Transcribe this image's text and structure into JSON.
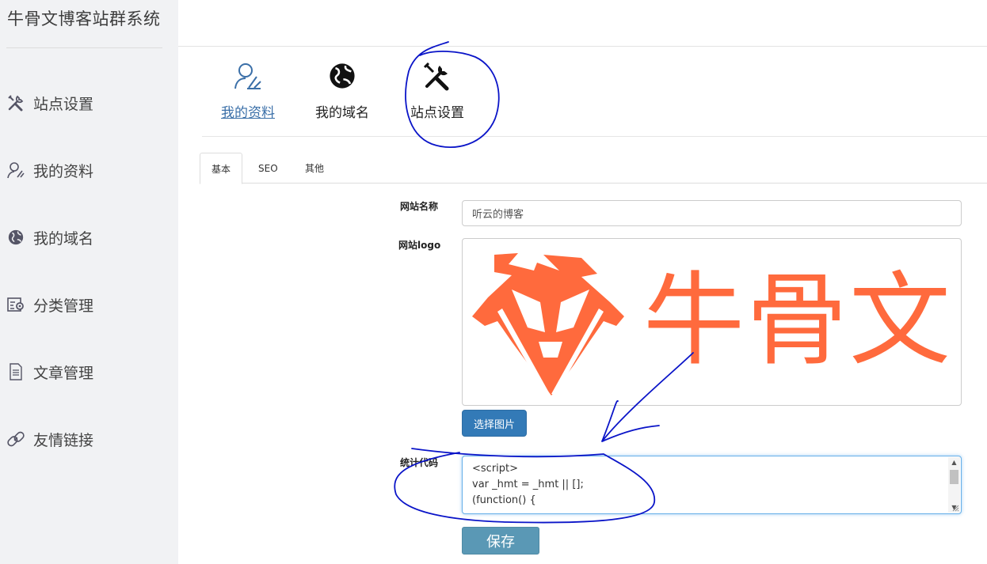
{
  "app": {
    "brand": "牛骨文博客站群系统"
  },
  "sidebar": {
    "items": [
      {
        "label": "站点设置",
        "icon": "tools-icon"
      },
      {
        "label": "我的资料",
        "icon": "user-icon"
      },
      {
        "label": "我的域名",
        "icon": "globe-icon"
      },
      {
        "label": "分类管理",
        "icon": "category-settings-icon"
      },
      {
        "label": "文章管理",
        "icon": "document-icon"
      },
      {
        "label": "友情链接",
        "icon": "link-icon"
      }
    ]
  },
  "header_tabs": [
    {
      "label": "我的资料",
      "icon": "user-icon",
      "active": true
    },
    {
      "label": "我的域名",
      "icon": "globe-icon",
      "active": false
    },
    {
      "label": "站点设置",
      "icon": "tools-icon",
      "active": false
    }
  ],
  "sub_tabs": [
    {
      "label": "基本",
      "active": true
    },
    {
      "label": "SEO",
      "active": false
    },
    {
      "label": "其他",
      "active": false
    }
  ],
  "form": {
    "site_name_label": "网站名称",
    "site_name_value": "听云的博客",
    "site_logo_label": "网站logo",
    "logo_text": "牛骨文",
    "pick_image_button": "选择图片",
    "stats_code_label": "统计代码",
    "stats_code_lines": [
      "<script>",
      "var _hmt = _hmt || [];",
      "(function() {"
    ],
    "save_button": "保存"
  },
  "colors": {
    "sidebar_bg": "#f1f2f4",
    "primary_button": "#337ab7",
    "save_button": "#5a98b5",
    "logo_orange": "#ff6a3d",
    "active_tab_text": "#3a6fa8",
    "annotation_ink": "#0a14c8"
  }
}
